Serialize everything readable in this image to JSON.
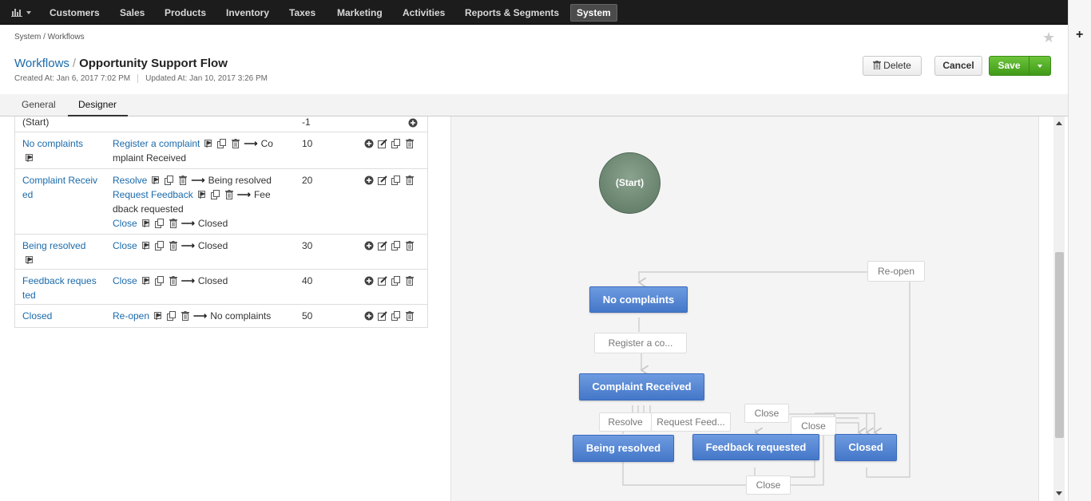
{
  "nav": {
    "items": [
      "Customers",
      "Sales",
      "Products",
      "Inventory",
      "Taxes",
      "Marketing",
      "Activities",
      "Reports & Segments",
      "System"
    ],
    "active": "System"
  },
  "header": {
    "breadcrumb": "System / Workflows",
    "title_link": "Workflows",
    "title_sep": "/",
    "title_name": "Opportunity  Support Flow",
    "created": "Created At: Jan 6, 2017 7:02 PM",
    "updated": "Updated At: Jan 10, 2017 3:26 PM"
  },
  "buttons": {
    "delete": "Delete",
    "cancel": "Cancel",
    "save": "Save"
  },
  "tabs": [
    "General",
    "Designer"
  ],
  "active_tab": "Designer",
  "table": {
    "start_row": {
      "step": "(Start)",
      "order": "-1"
    },
    "rows": [
      {
        "step_lines": [
          "No complaints"
        ],
        "transitions": [
          {
            "name": "Register a complaint",
            "target_lines": [
              "Co",
              "mplaint Received"
            ]
          }
        ],
        "order": "10"
      },
      {
        "step_lines": [
          "Complaint Receiv",
          "ed"
        ],
        "transitions": [
          {
            "name": "Resolve",
            "target_lines": [
              "Being resolved"
            ]
          },
          {
            "name": "Request Feedback",
            "target_lines": [
              "Fee",
              "dback requested"
            ]
          },
          {
            "name": "Close",
            "target_lines": [
              "Closed"
            ]
          }
        ],
        "order": "20"
      },
      {
        "step_lines": [
          "Being resolved"
        ],
        "transitions": [
          {
            "name": "Close",
            "target_lines": [
              "Closed"
            ]
          }
        ],
        "order": "30"
      },
      {
        "step_lines": [
          "Feedback reques",
          "ted"
        ],
        "transitions": [
          {
            "name": "Close",
            "target_lines": [
              "Closed"
            ]
          }
        ],
        "order": "40"
      },
      {
        "step_lines": [
          "Closed"
        ],
        "transitions": [
          {
            "name": "Re-open",
            "target_lines": [
              "No complaints"
            ]
          }
        ],
        "order": "50"
      }
    ]
  },
  "diagram": {
    "start": "(Start)",
    "nodes": {
      "no_complaints": "No complaints",
      "complaint_received": "Complaint Received",
      "being_resolved": "Being resolved",
      "feedback_requested": "Feedback requested",
      "closed": "Closed"
    },
    "labels": {
      "reopen": "Re-open",
      "register": "Register a co...",
      "resolve": "Resolve",
      "request_feed": "Request Feed...",
      "close1": "Close",
      "close2": "Close",
      "close3": "Close"
    }
  },
  "colors": {
    "link": "#1a6aab",
    "node": "#4f7fd0",
    "save": "#4fae22",
    "nav": "#1c1c1c"
  }
}
